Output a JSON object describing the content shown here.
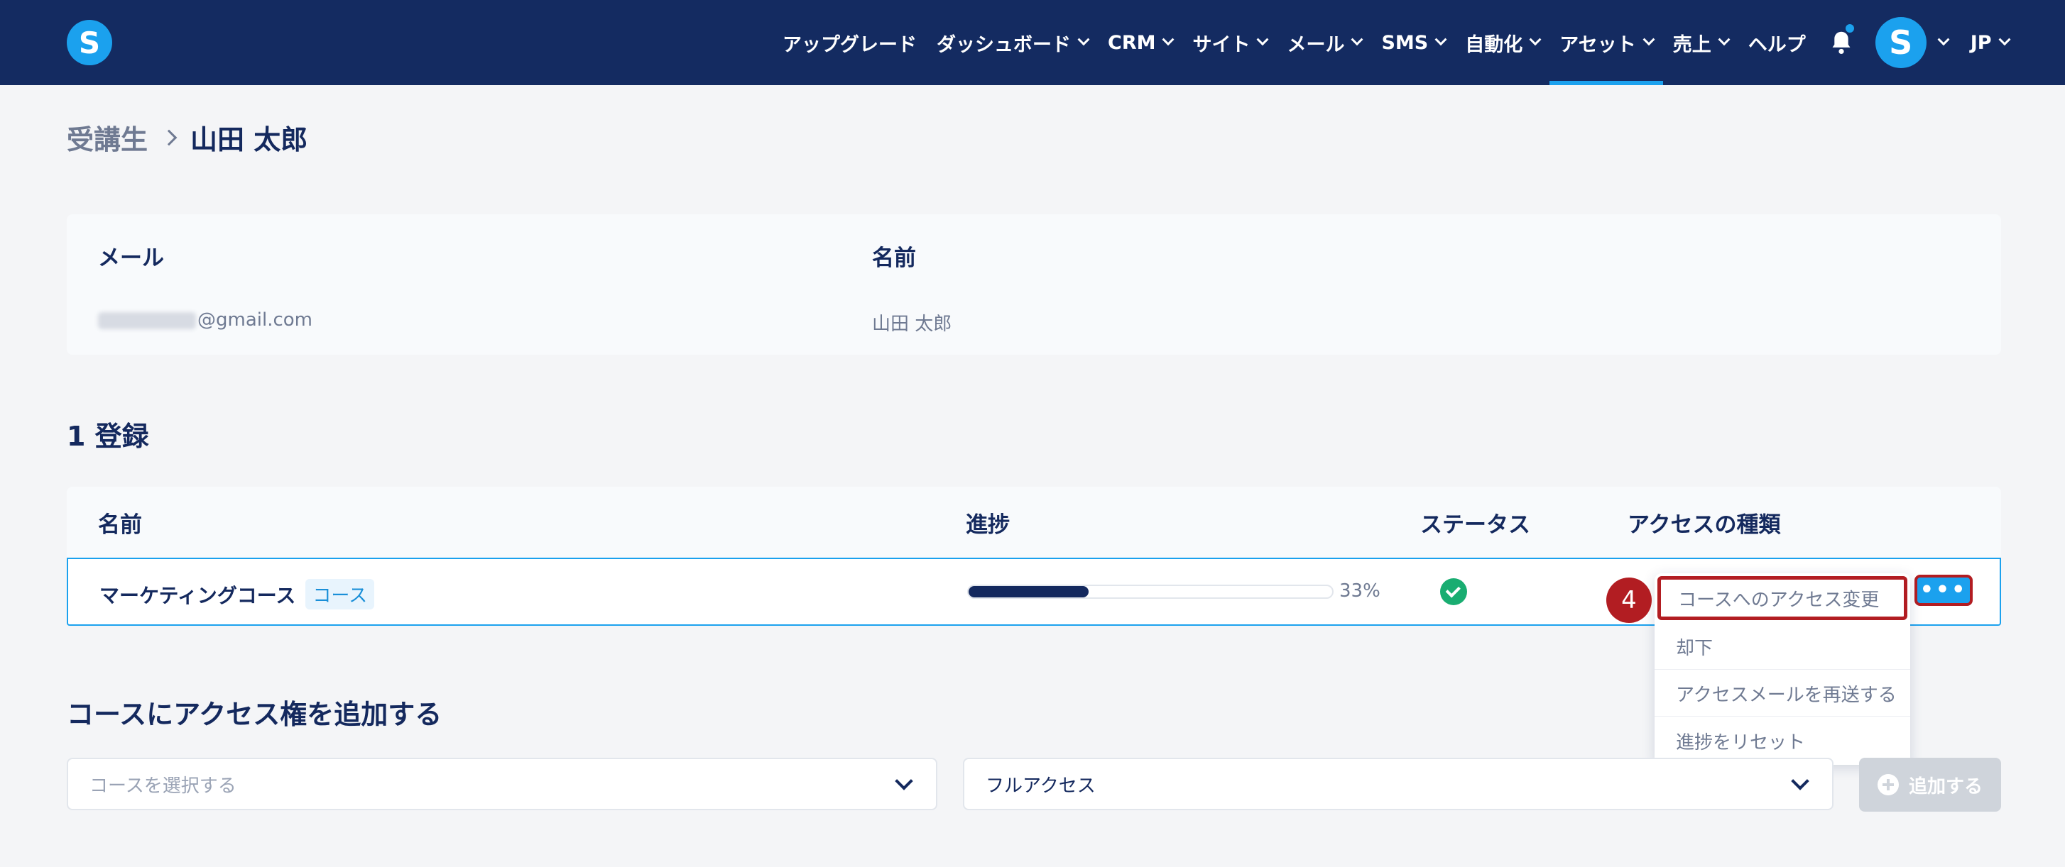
{
  "logo": {
    "letter": "S"
  },
  "nav": [
    {
      "label": "アップグレード",
      "dropdown": false,
      "active": false
    },
    {
      "label": "ダッシュボード",
      "dropdown": true,
      "active": false
    },
    {
      "label": "CRM",
      "dropdown": true,
      "active": false
    },
    {
      "label": "サイト",
      "dropdown": true,
      "active": false
    },
    {
      "label": "メール",
      "dropdown": true,
      "active": false
    },
    {
      "label": "SMS",
      "dropdown": true,
      "active": false
    },
    {
      "label": "自動化",
      "dropdown": true,
      "active": false
    },
    {
      "label": "アセット",
      "dropdown": true,
      "active": true
    },
    {
      "label": "売上",
      "dropdown": true,
      "active": false
    },
    {
      "label": "ヘルプ",
      "dropdown": false,
      "active": false
    }
  ],
  "user": {
    "avatar_letter": "S",
    "lang": "JP"
  },
  "breadcrumb": {
    "parent": "受講生",
    "current": "山田 太郎"
  },
  "info": {
    "email_label": "メール",
    "email_value": "@gmail.com",
    "name_label": "名前",
    "name_value": "山田 太郎"
  },
  "enrollments": {
    "title": "1 登録",
    "headers": {
      "name": "名前",
      "progress": "進捗",
      "status": "ステータス",
      "access": "アクセスの種類"
    },
    "rows": [
      {
        "name": "マーケティングコース",
        "tag": "コース",
        "progress": 0.33,
        "progress_text": "33%",
        "status": "active"
      }
    ]
  },
  "more_button": {
    "label": "•••"
  },
  "menu": {
    "step": "4",
    "items": [
      "コースへのアクセス変更",
      "却下",
      "アクセスメールを再送する",
      "進捗をリセット"
    ]
  },
  "add_access": {
    "title": "コースにアクセス権を追加する",
    "course_placeholder": "コースを選択する",
    "access_value": "フルアクセス",
    "button_label": "追加する"
  },
  "colors": {
    "nav_bg": "#142b61",
    "accent": "#1ba1ee",
    "highlight": "#b21d22",
    "success": "#19ad71"
  }
}
